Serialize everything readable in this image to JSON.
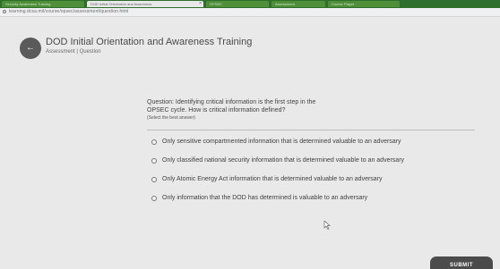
{
  "browser": {
    "tabs": [
      {
        "label": "Security Awareness Training"
      },
      {
        "label": "DOD Initial Orientation and Awareness"
      },
      {
        "label": "OPSEC"
      },
      {
        "label": "Assessment"
      },
      {
        "label": "Course Player"
      }
    ],
    "close_glyph": "×",
    "url": "learning.dcsa.mil/course/opsec/assessment/question.html"
  },
  "course": {
    "back_glyph": "←",
    "title": "DOD Initial Orientation and Awareness Training",
    "subtitle": "Assessment | Question"
  },
  "question": {
    "text": "Question: Identifying critical information is the first step in the OPSEC cycle. How is critical information defined?",
    "hint": "(Select the best answer)"
  },
  "options": [
    {
      "label": "Only sensitive compartmented information that is determined valuable to an adversary"
    },
    {
      "label": "Only classified national security information that is determined valuable to an adversary"
    },
    {
      "label": "Only Atomic Energy Act information that is determined valuable to an adversary"
    },
    {
      "label": "Only information that the DOD has determined is valuable to an adversary"
    }
  ],
  "submit_label": "SUBMIT",
  "icons": {
    "lock": "lock-icon",
    "back": "arrow-left-icon",
    "cursor": "pointer-cursor-icon"
  },
  "colors": {
    "tab_strip": "#2f6f2e",
    "background": "#e9e9e9",
    "submit": "#4b4b4b"
  }
}
